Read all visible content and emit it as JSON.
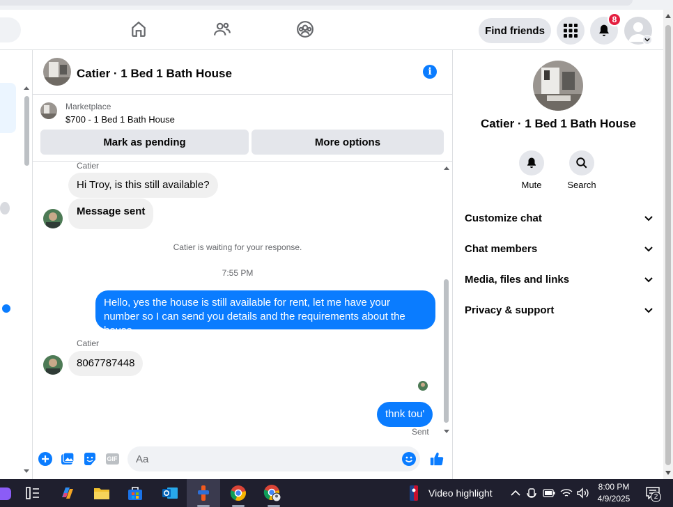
{
  "header": {
    "find_friends_label": "Find friends",
    "notification_count": "8"
  },
  "chat": {
    "title": "Catier · 1 Bed 1 Bath House",
    "marketplace": {
      "label": "Marketplace",
      "item": "$700 - 1 Bed 1 Bath House",
      "pending_label": "Mark as pending",
      "more_label": "More options"
    },
    "messages": {
      "sender_1": "Catier",
      "msg_1": "Hi Troy, is this still available?",
      "msg_2": "Message sent",
      "waiting_note": "Catier is waiting for your response.",
      "timestamp": "7:55 PM",
      "msg_3": "Hello, yes the house is still available for rent, let me have your number so I can send you details and the requirements about the house",
      "sender_2": "Catier",
      "msg_4": "8067787448",
      "msg_5": "thnk tou'",
      "status": "Sent"
    },
    "composer": {
      "placeholder": "Aa",
      "gif_label": "GIF"
    }
  },
  "details": {
    "title": "Catier · 1 Bed 1 Bath House",
    "mute_label": "Mute",
    "search_label": "Search",
    "sections": [
      "Customize chat",
      "Chat members",
      "Media, files and links",
      "Privacy & support"
    ]
  },
  "taskbar": {
    "news_text": "Video highlight",
    "time": "8:00 PM",
    "date": "4/9/2025",
    "notif_count": "2"
  },
  "colors": {
    "accent": "#0a7cff",
    "badge": "#e41e3f",
    "bubble_in": "#f0f0f0"
  }
}
